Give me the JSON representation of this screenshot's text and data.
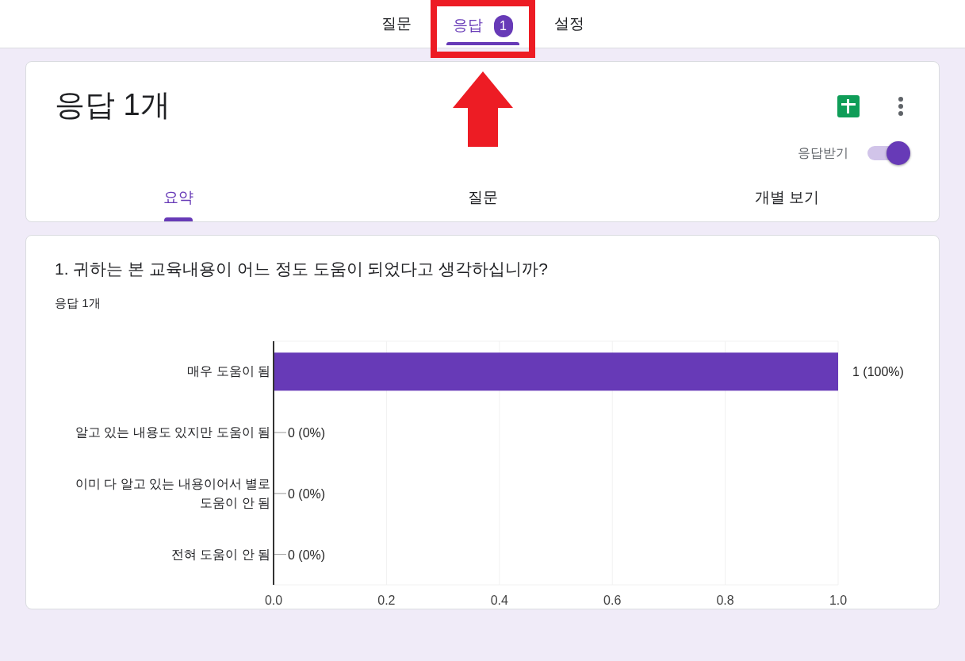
{
  "top_tabs": [
    {
      "label": "질문",
      "selected": false
    },
    {
      "label": "응답",
      "selected": true,
      "badge": "1"
    },
    {
      "label": "설정",
      "selected": false
    }
  ],
  "annotation": {
    "color": "#ed1c24"
  },
  "summary_card": {
    "title": "응답 1개",
    "accepting_label": "응답받기",
    "accepting": true,
    "sub_tabs": [
      {
        "label": "요약",
        "selected": true
      },
      {
        "label": "질문",
        "selected": false
      },
      {
        "label": "개별 보기",
        "selected": false
      }
    ]
  },
  "question": {
    "title": "1. 귀하는 본 교육내용이 어느 정도 도움이 되었다고 생각하십니까?",
    "count": "응답 1개",
    "chart_data": {
      "type": "bar",
      "orientation": "horizontal",
      "categories": [
        "매우 도움이 됨",
        "알고 있는 내용도 있지만 도움이 됨",
        "이미 다 알고 있는 내용이어서 별로 도움이 안 됨",
        "전혀 도움이 안 됨"
      ],
      "series": [
        {
          "color": "#673ab7",
          "values": [
            1,
            0,
            0,
            0
          ]
        }
      ],
      "grid": true,
      "xlim": [
        0,
        1
      ],
      "xticks": [
        {
          "value": 0,
          "label": "0.0"
        },
        {
          "value": 0.2,
          "label": "0.2"
        },
        {
          "value": 0.4,
          "label": "0.4"
        },
        {
          "value": 0.6,
          "label": "0.6"
        },
        {
          "value": 0.8,
          "label": "0.8"
        },
        {
          "value": 1,
          "label": "1.0"
        }
      ],
      "value_labels": [
        "1 (100%)",
        "0 (0%)",
        "0 (0%)",
        "0 (0%)"
      ]
    }
  }
}
